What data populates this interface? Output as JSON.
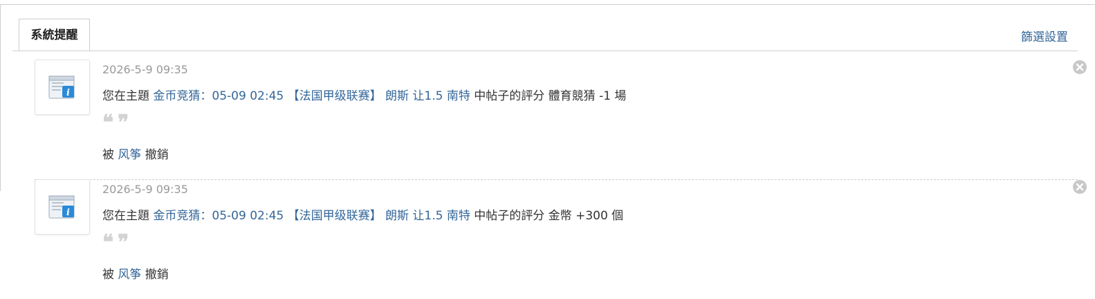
{
  "tabs": {
    "active_label": "系統提醒",
    "filter_label": "篩選設置"
  },
  "notices": [
    {
      "time": "2026-5-9 09:35",
      "prefix": "您在主題 ",
      "thread_link": "金币竞猜：05-09 02:45 【法国甲级联赛】 朗斯 让1.5 南特",
      "middle": " 中帖子的評分 ",
      "rating": "體育競猜 -1 場",
      "quote_open": "❝",
      "quote_close": "❞",
      "by_label": "被 ",
      "user_link": "风筝",
      "action": " 撤銷"
    },
    {
      "time": "2026-5-9 09:35",
      "prefix": "您在主題 ",
      "thread_link": "金币竞猜：05-09 02:45 【法国甲级联赛】 朗斯 让1.5 南特",
      "middle": " 中帖子的評分 ",
      "rating": "金幣 +300 個",
      "quote_open": "❝",
      "quote_close": "❞",
      "by_label": "被 ",
      "user_link": "风筝",
      "action": " 撤銷"
    }
  ],
  "colors": {
    "link": "#336699",
    "meta": "#999999",
    "border": "#cdcdcd"
  },
  "icons": {
    "notice": "system-info-icon",
    "delete": "close-circle-icon"
  }
}
